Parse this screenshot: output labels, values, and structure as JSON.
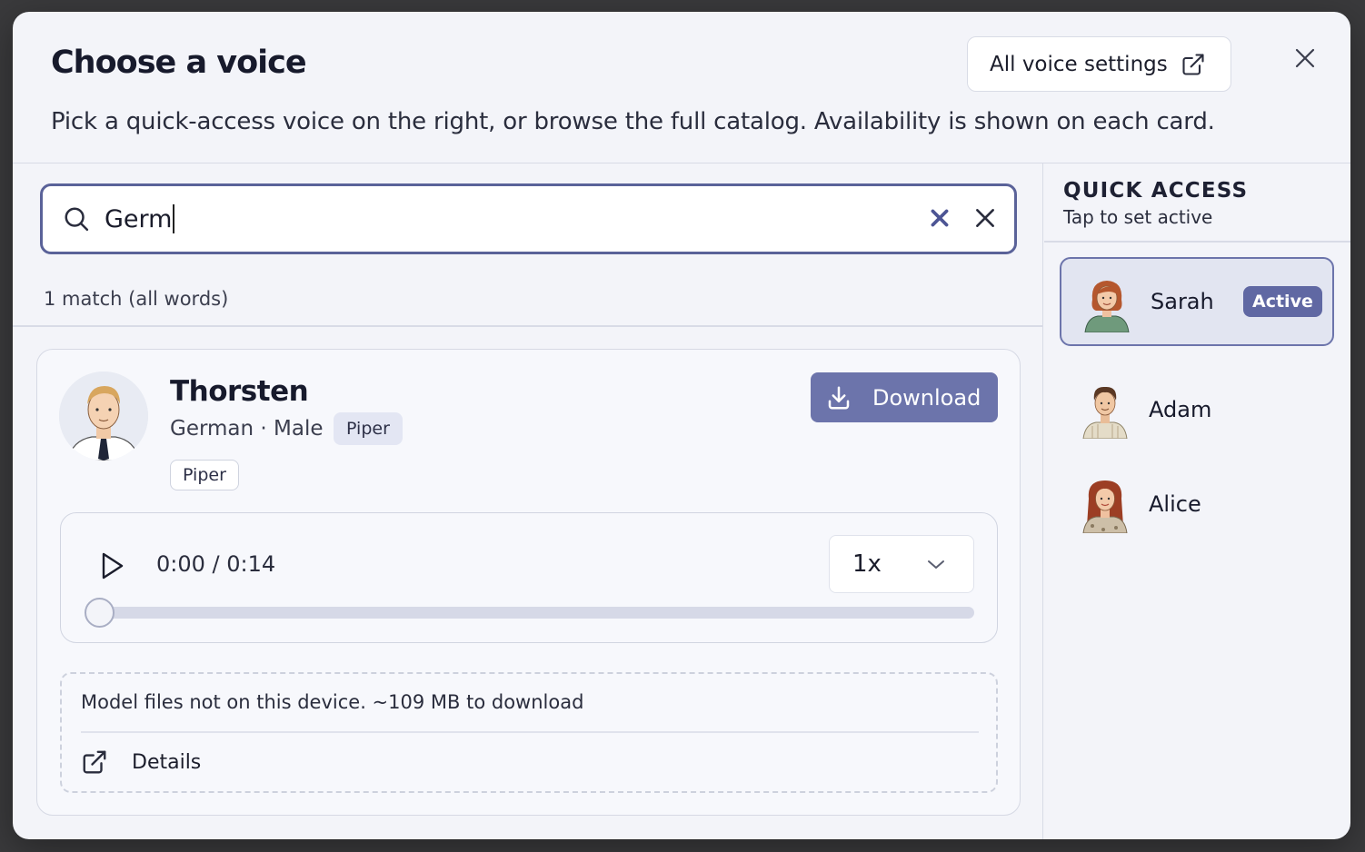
{
  "modal": {
    "title": "Choose a voice",
    "subtitle": "Pick a quick-access voice on the right, or browse the full catalog. Availability is shown on each card.",
    "settings_button": "All voice settings",
    "icons": {
      "settings": "external-link-icon",
      "close": "close-icon"
    }
  },
  "search": {
    "value": "Germ",
    "match_text": "1 match (all words)",
    "icons": {
      "search": "search-icon",
      "clear": "clear-x-icon",
      "close": "close-x-icon"
    }
  },
  "results": [
    {
      "name": "Thorsten",
      "meta": "German · Male",
      "engine_tag": "Piper",
      "extra_tag": "Piper",
      "download_label": "Download",
      "player": {
        "time": "0:00 / 0:14",
        "speed": "1x",
        "progress": 0
      },
      "info": "Model files not on this device. ~109 MB to download",
      "details_label": "Details"
    }
  ],
  "quick_access": {
    "title": "QUICK ACCESS",
    "subtitle": "Tap to set active",
    "items": [
      {
        "name": "Sarah",
        "badge": "Active",
        "active": true
      },
      {
        "name": "Adam",
        "badge": "",
        "active": false
      },
      {
        "name": "Alice",
        "badge": "",
        "active": false
      }
    ]
  },
  "colors": {
    "accent": "#6c74ab",
    "active_badge": "#6068a3",
    "modal_bg": "#f3f4f9",
    "search_border": "#5a6299"
  }
}
